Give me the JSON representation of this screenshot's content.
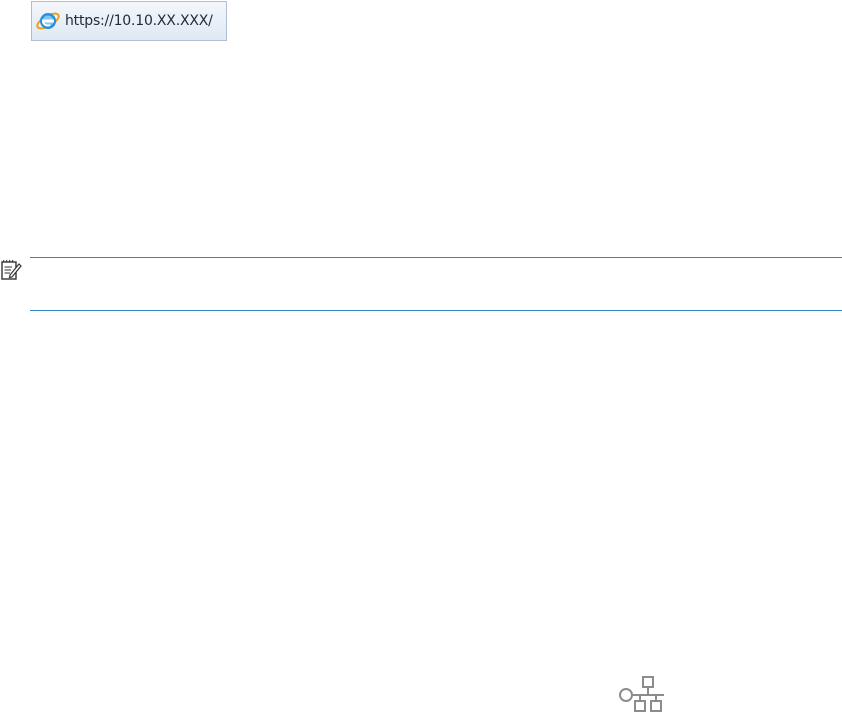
{
  "address_bar": {
    "url": "https://10.10.XX.XXX/",
    "browser_icon": "internet-explorer-icon"
  },
  "note": {
    "icon": "note-icon"
  },
  "network": {
    "icon": "network-icon"
  },
  "colors": {
    "note_rule": "#2f86c6",
    "address_bar_border": "#aebfd4",
    "icon_gray": "#8c8c8c"
  }
}
